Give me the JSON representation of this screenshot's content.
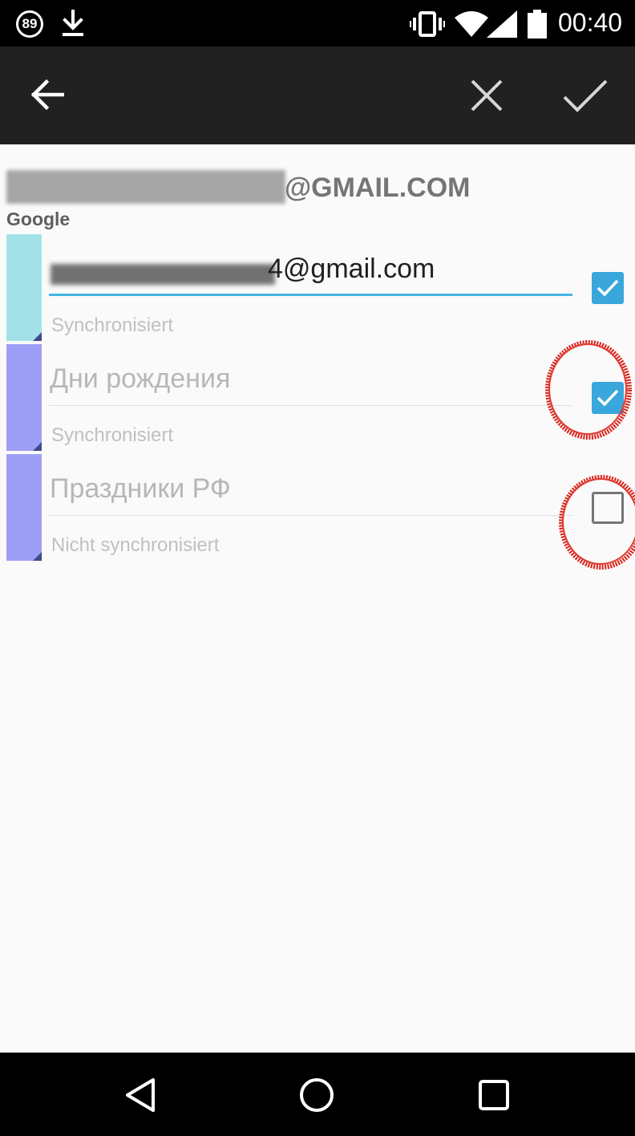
{
  "status_bar": {
    "notification_count": "89",
    "time": "00:40",
    "icons": [
      "notification-count-icon",
      "download-icon",
      "vibrate-icon",
      "wifi-icon",
      "signal-icon",
      "battery-icon"
    ]
  },
  "toolbar": {
    "icons": [
      "back-arrow-icon",
      "close-icon",
      "checkmark-icon"
    ]
  },
  "account": {
    "email_suffix": "@GMAIL.COM",
    "type": "Google"
  },
  "calendars": [
    {
      "name": "4@gmail.com",
      "status": "Synchronisiert",
      "checked": true,
      "color": "#a2e2e6",
      "editing": true
    },
    {
      "name": "Дни рождения",
      "status": "Synchronisiert",
      "checked": true,
      "color": "#9d9ff7",
      "editing": false
    },
    {
      "name": "Праздники РФ",
      "status": "Nicht synchronisiert",
      "checked": false,
      "color": "#9d9ff7",
      "editing": false
    }
  ],
  "colors": {
    "status_bar": "#000000",
    "toolbar": "#212121",
    "accent": "#3aa7dc",
    "input_underline": "#43b4e2",
    "annotation": "#d9241c",
    "background": "#fafafa"
  },
  "nav_bar": {
    "icons": [
      "nav-back-icon",
      "nav-home-icon",
      "nav-recents-icon"
    ]
  }
}
